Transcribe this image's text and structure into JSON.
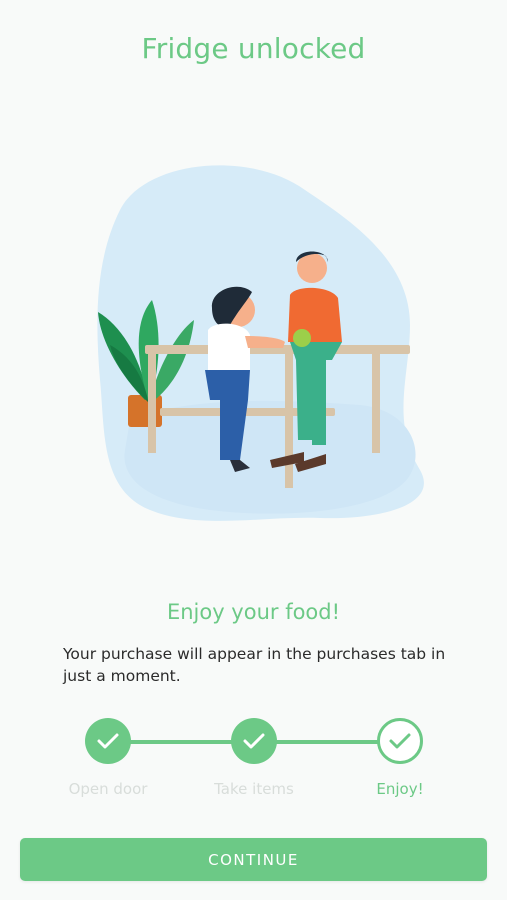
{
  "header": {
    "title": "Fridge unlocked"
  },
  "illustration": {
    "icon": "people-eating-illustration"
  },
  "status": {
    "heading": "Enjoy your food!",
    "message": "Your purchase will appear in the purchases tab in just a moment."
  },
  "progress": {
    "steps": [
      {
        "label": "Open door",
        "state": "done"
      },
      {
        "label": "Take items",
        "state": "done"
      },
      {
        "label": "Enjoy!",
        "state": "current"
      }
    ]
  },
  "actions": {
    "continue_label": "CONTINUE"
  },
  "colors": {
    "accent": "#6cc986",
    "muted": "#d8ddda",
    "background": "#f8faf9"
  }
}
